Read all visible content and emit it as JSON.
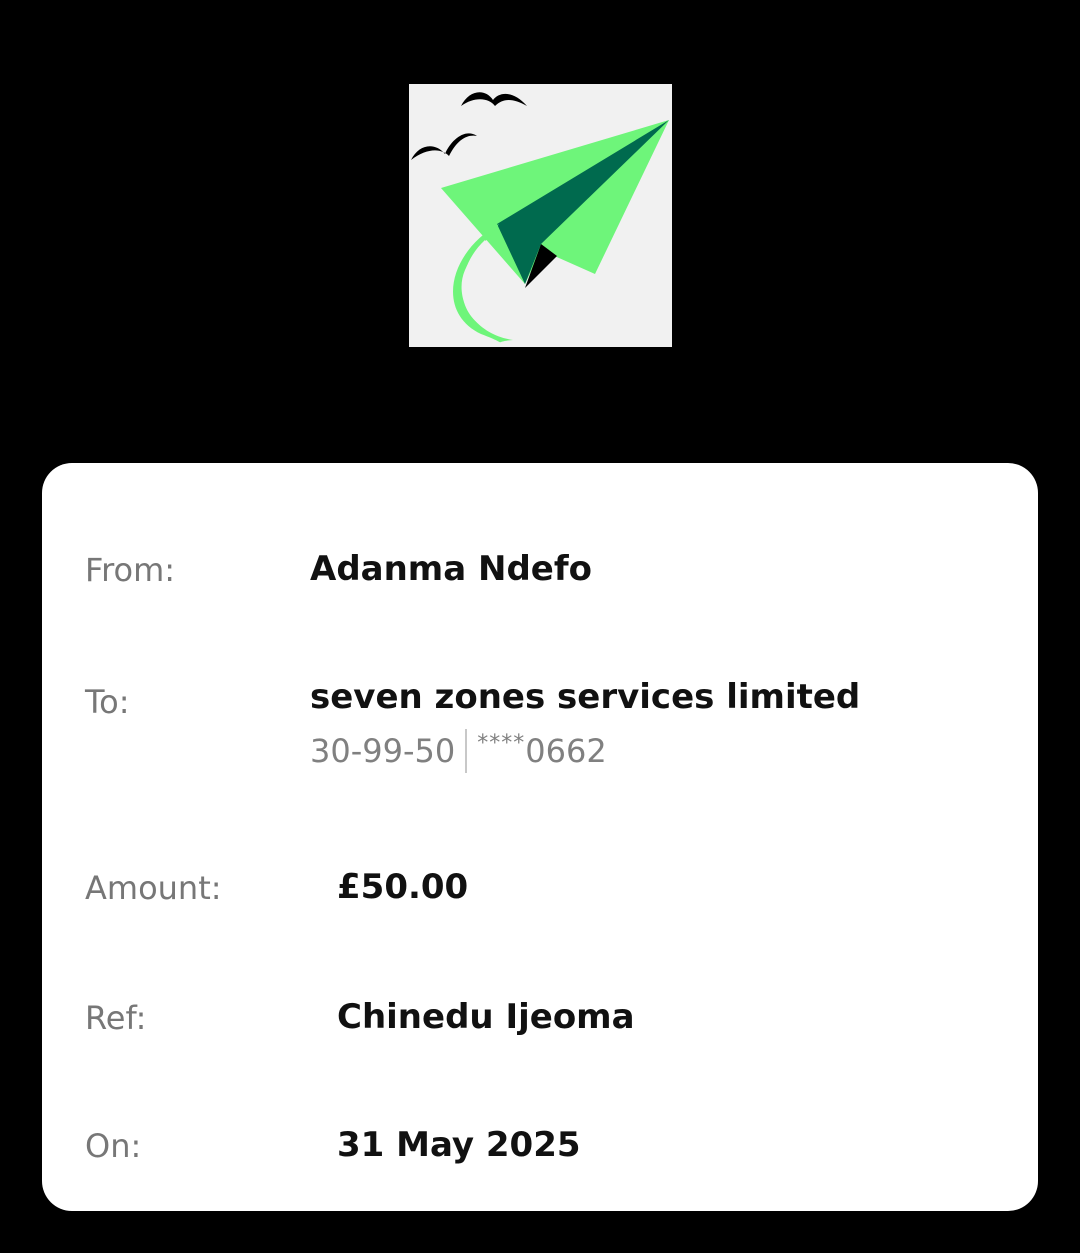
{
  "logo": {
    "icon": "paper-plane-with-birds-logo",
    "colors": {
      "tile": "#f1f1f1",
      "plane_light": "#6ef57a",
      "plane_dark": "#006a4e",
      "birds": "#000000"
    }
  },
  "transfer": {
    "from": {
      "label": "From:",
      "value": "Adanma Ndefo"
    },
    "to": {
      "label": "To:",
      "value": "seven zones services limited",
      "sort_code": "30-99-50",
      "account_mask": "****",
      "account_last": "0662"
    },
    "amount": {
      "label": "Amount:",
      "value": "£50.00"
    },
    "ref": {
      "label": "Ref:",
      "value": "Chinedu Ijeoma"
    },
    "on": {
      "label": "On:",
      "value": "31 May 2025"
    }
  }
}
